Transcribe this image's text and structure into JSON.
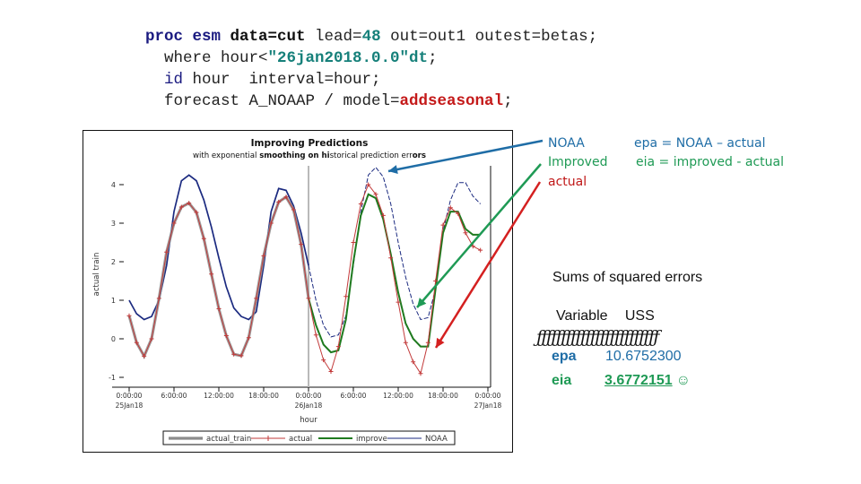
{
  "code": {
    "line1": {
      "kw": "proc esm",
      "ds": "data=cut",
      "lead_label": " lead=",
      "lead_val": "48",
      "rest": " out=out1 outest=betas;"
    },
    "line2": {
      "pre": "  where hour<",
      "val": "\"26jan2018.0.0\"dt",
      "post": ";"
    },
    "line3": {
      "kw": "  id",
      "rest": " hour  interval=hour;"
    },
    "line4": {
      "pre": "  forecast A_NOAAP / model=",
      "val": "addseasonal",
      "post": ";"
    }
  },
  "annotations": {
    "legend_noaa": "NOAA",
    "legend_improved": "Improved",
    "legend_actual": "actual",
    "formula_epa": "epa = NOAA – actual",
    "formula_eia": "eia = improved - actual"
  },
  "sse": {
    "title": "Sums of squared errors",
    "header": "Variable   USS",
    "separator": "ƒƒƒƒƒƒƒƒƒƒƒƒƒƒƒƒƒƒƒƒƒƒƒƒƒ",
    "rows": [
      {
        "variable": "epa",
        "uss": "10.6752300"
      },
      {
        "variable": "eia",
        "uss": "3.6772151",
        "emoji": "☺"
      }
    ]
  },
  "colors": {
    "noaa": "#1b2a80",
    "actual": "#c23a3a",
    "actual_train": "#8c8c8c",
    "improve": "#1f7a1f",
    "arrow_blue": "#1f6da6",
    "arrow_green": "#1f9a55",
    "arrow_red": "#d42020"
  },
  "chart_data": {
    "type": "line",
    "title": "Improving Predictions",
    "subtitle_parts": [
      {
        "text": "with exponential ",
        "bold": false
      },
      {
        "text": "smoothing on hi",
        "bold": true
      },
      {
        "text": "storical prediction err",
        "bold": false
      },
      {
        "text": "ors",
        "bold": true
      }
    ],
    "xlabel": "hour",
    "ylabel": "actual train",
    "x_unit": "hours since 25Jan18 0:00:00",
    "xlim": [
      0,
      48
    ],
    "ylim": [
      -1.15,
      4.5
    ],
    "yticks": [
      -1,
      0,
      1,
      2,
      3,
      4
    ],
    "ytick_labels": [
      "-1",
      "0",
      "1",
      "2",
      "3",
      "4"
    ],
    "xticks": [
      0,
      6,
      12,
      18,
      24,
      30,
      36,
      42,
      48
    ],
    "xtick_labels": [
      [
        "0:00:00",
        "25Jan18"
      ],
      [
        "6:00:00",
        ""
      ],
      [
        "12:00:00",
        ""
      ],
      [
        "18:00:00",
        ""
      ],
      [
        "0:00:00",
        "26Jan18"
      ],
      [
        "6:00:00",
        ""
      ],
      [
        "12:00:00",
        ""
      ],
      [
        "18:00:00",
        ""
      ],
      [
        "0:00:00",
        "27Jan18"
      ]
    ],
    "reference_line_x": 24,
    "legend": [
      "actual_train",
      "actual",
      "improve",
      "NOAA"
    ],
    "legend_position": "bottom",
    "series": [
      {
        "name": "NOAA",
        "style": "solid-then-dashed",
        "x": [
          0,
          1,
          2,
          3,
          4,
          5,
          6,
          7,
          8,
          9,
          10,
          11,
          12,
          13,
          14,
          15,
          16,
          17,
          18,
          19,
          20,
          21,
          22,
          23,
          24,
          25,
          26,
          27,
          28,
          29,
          30,
          31,
          32,
          33,
          34,
          35,
          36,
          37,
          38,
          39,
          40,
          41,
          42,
          43,
          44,
          45,
          46,
          47
        ],
        "y": [
          1.0,
          0.65,
          0.5,
          0.58,
          1.0,
          1.9,
          3.3,
          4.1,
          4.25,
          4.1,
          3.6,
          2.9,
          2.1,
          1.35,
          0.8,
          0.58,
          0.5,
          0.7,
          1.9,
          3.3,
          3.9,
          3.85,
          3.45,
          2.75,
          1.9,
          1.0,
          0.35,
          0.05,
          0.1,
          0.6,
          1.9,
          3.3,
          4.25,
          4.45,
          4.2,
          3.5,
          2.5,
          1.6,
          0.9,
          0.5,
          0.55,
          1.3,
          2.8,
          3.6,
          4.05,
          4.05,
          3.7,
          3.5
        ]
      },
      {
        "name": "actual_train",
        "style": "thick-gray",
        "x": [
          0,
          1,
          2,
          3,
          4,
          5,
          6,
          7,
          8,
          9,
          10,
          11,
          12,
          13,
          14,
          15,
          16,
          17,
          18,
          19,
          20,
          21,
          22,
          23,
          24
        ],
        "y": [
          0.6,
          -0.1,
          -0.45,
          0.0,
          1.05,
          2.25,
          3.0,
          3.42,
          3.52,
          3.28,
          2.6,
          1.68,
          0.78,
          0.08,
          -0.4,
          -0.44,
          0.03,
          1.05,
          2.15,
          3.0,
          3.55,
          3.68,
          3.35,
          2.45,
          1.05
        ]
      },
      {
        "name": "actual",
        "style": "thin-red-plus",
        "x": [
          0,
          1,
          2,
          3,
          4,
          5,
          6,
          7,
          8,
          9,
          10,
          11,
          12,
          13,
          14,
          15,
          16,
          17,
          18,
          19,
          20,
          21,
          22,
          23,
          24,
          25,
          26,
          27,
          28,
          29,
          30,
          31,
          32,
          33,
          34,
          35,
          36,
          37,
          38,
          39,
          40,
          41,
          42,
          43,
          44,
          45,
          46,
          47
        ],
        "y": [
          0.6,
          -0.1,
          -0.45,
          0.0,
          1.05,
          2.25,
          3.0,
          3.42,
          3.52,
          3.28,
          2.6,
          1.68,
          0.78,
          0.08,
          -0.4,
          -0.44,
          0.03,
          1.05,
          2.15,
          3.0,
          3.55,
          3.68,
          3.35,
          2.45,
          1.05,
          0.1,
          -0.55,
          -0.85,
          -0.2,
          1.1,
          2.5,
          3.5,
          4.0,
          3.75,
          3.2,
          2.1,
          0.95,
          -0.1,
          -0.6,
          -0.9,
          -0.1,
          1.5,
          2.95,
          3.4,
          3.25,
          2.75,
          2.4,
          2.3
        ]
      },
      {
        "name": "improve",
        "style": "green",
        "x": [
          24,
          25,
          26,
          27,
          28,
          29,
          30,
          31,
          32,
          33,
          34,
          35,
          36,
          37,
          38,
          39,
          40,
          41,
          42,
          43,
          44,
          45,
          46,
          47
        ],
        "y": [
          1.05,
          0.35,
          -0.15,
          -0.35,
          -0.3,
          0.5,
          2.0,
          3.2,
          3.75,
          3.65,
          3.1,
          2.2,
          1.2,
          0.4,
          0.0,
          -0.2,
          -0.2,
          1.3,
          2.75,
          3.3,
          3.3,
          2.85,
          2.7,
          2.7
        ]
      }
    ]
  }
}
